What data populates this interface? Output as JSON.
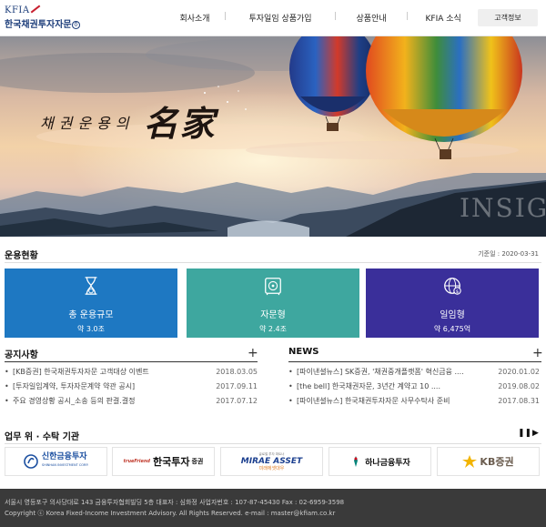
{
  "header": {
    "logo_top": "KFIA",
    "logo_name": "한국채권투자자문",
    "logo_suffix": "주",
    "menu": [
      "회사소개",
      "투자일임 상품가입",
      "상품안내",
      "KFIA 소식"
    ],
    "customer_button": "고객정보"
  },
  "hero": {
    "title_small": "채권운용의",
    "title_big": "名家",
    "watermark": "INSIG"
  },
  "operations": {
    "title": "운용현황",
    "base_date": "기준일 : 2020-03-31",
    "cards": [
      {
        "label": "총 운용규모",
        "value": "약 3.0조",
        "icon": "hourglass-money-icon",
        "color": "#1e78c2"
      },
      {
        "label": "자문형",
        "value": "약 2.4조",
        "icon": "safe-icon",
        "color": "#3ea79f"
      },
      {
        "label": "일임형",
        "value": "약 6,475억",
        "icon": "globe-dollar-icon",
        "color": "#3a2f9a"
      }
    ]
  },
  "notices": {
    "title": "공지사항",
    "items": [
      {
        "text": "[KB증권] 한국채권투자자문 고객대상 이벤트",
        "date": "2018.03.05"
      },
      {
        "text": "[투자일임계약, 투자자문계약 약관 공시]",
        "date": "2017.09.11"
      },
      {
        "text": "주요 경영상황 공시_소송 등의 판결.결정",
        "date": "2017.07.12"
      }
    ]
  },
  "news": {
    "title": "NEWS",
    "items": [
      {
        "text": "[파이낸셜뉴스] SK증권, '채권중개플랫폼' 혁신금융 ....",
        "date": "2020.01.02"
      },
      {
        "text": "[the bell] 한국채권자문, 3년간 계약고 10 ....",
        "date": "2019.08.02"
      },
      {
        "text": "[파이낸셜뉴스] 한국채권투자자문 사무수탁사 준비",
        "date": "2017.08.31"
      }
    ]
  },
  "partners": {
    "title": "업무 위 · 수탁 기관",
    "pause": "❚❚",
    "next": "▶",
    "items": [
      {
        "name": "신한금융투자",
        "sub": "SHINHAN INVESTMENT CORP.",
        "color": "#1b4fa0"
      },
      {
        "name": "한국투자",
        "prefix": "trueFriend",
        "suffix": "증권",
        "color": "#111111"
      },
      {
        "name": "MIRAE ASSET",
        "sub": "미래에셋대우",
        "top": "글로벌 투자 파트너",
        "color": "#1b3f8f"
      },
      {
        "name": "하나금융투자",
        "color": "#00857a"
      },
      {
        "name": "KB증권",
        "color": "#6b5d4f"
      }
    ]
  },
  "footer": {
    "address": "서울시 영등포구 의사당대로 143 금융투자협회빌딩 5층 대표자 : 심화정 사업자번호 : 107-87-45430 Fax : 02-6959-3598",
    "copyright": "Copyright ⓒ Korea Fixed-Income Investment Advisory. All Rights Reserved. e-mail : master@kfiam.co.kr"
  }
}
